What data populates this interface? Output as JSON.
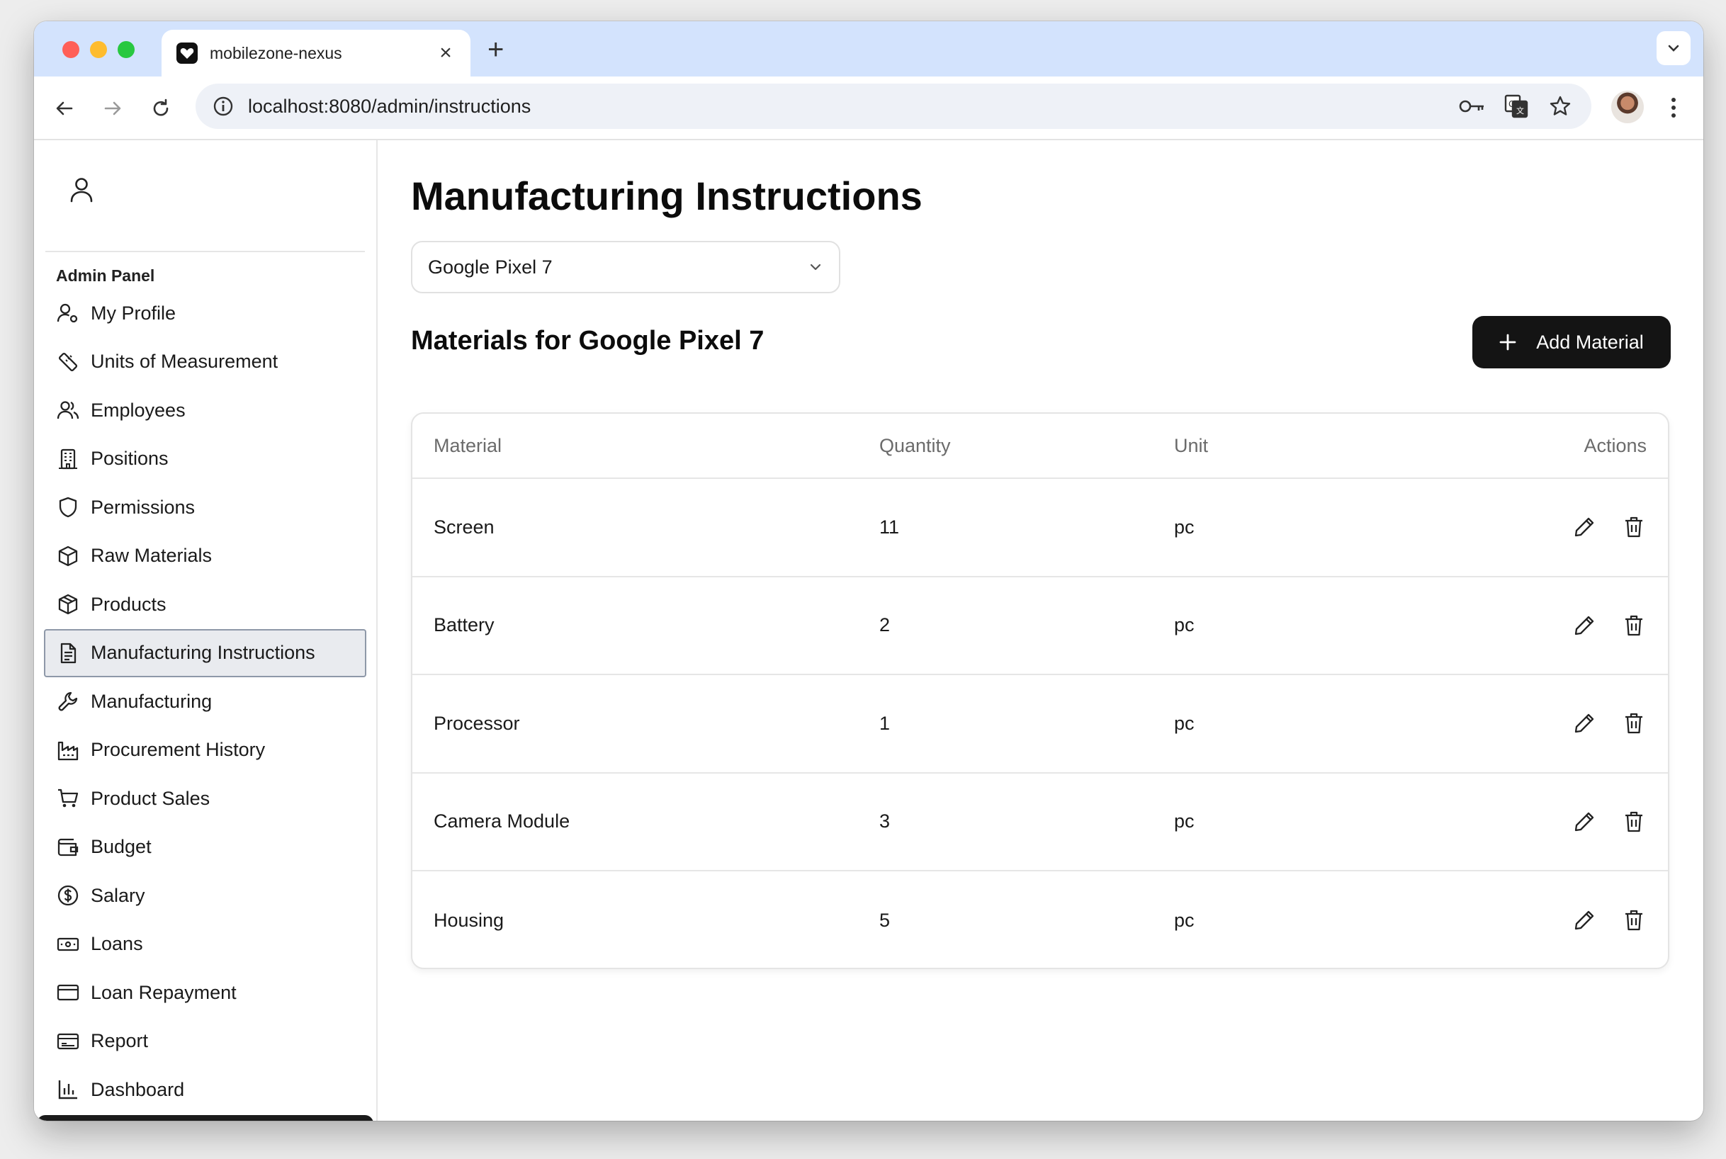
{
  "browser": {
    "tab_title": "mobilezone-nexus",
    "url": "localhost:8080/admin/instructions"
  },
  "sidebar": {
    "panel_label": "Admin Panel",
    "items": [
      {
        "label": "My Profile",
        "icon": "user-settings-icon"
      },
      {
        "label": "Units of Measurement",
        "icon": "ruler-icon"
      },
      {
        "label": "Employees",
        "icon": "users-icon"
      },
      {
        "label": "Positions",
        "icon": "building-icon"
      },
      {
        "label": "Permissions",
        "icon": "shield-icon"
      },
      {
        "label": "Raw Materials",
        "icon": "box-icon"
      },
      {
        "label": "Products",
        "icon": "package-icon"
      },
      {
        "label": "Manufacturing Instructions",
        "icon": "document-icon",
        "active": true
      },
      {
        "label": "Manufacturing",
        "icon": "wrench-icon"
      },
      {
        "label": "Procurement History",
        "icon": "factory-icon"
      },
      {
        "label": "Product Sales",
        "icon": "cart-icon"
      },
      {
        "label": "Budget",
        "icon": "wallet-icon"
      },
      {
        "label": "Salary",
        "icon": "dollar-circle-icon"
      },
      {
        "label": "Loans",
        "icon": "banknote-icon"
      },
      {
        "label": "Loan Repayment",
        "icon": "credit-card-icon"
      },
      {
        "label": "Report",
        "icon": "report-card-icon"
      },
      {
        "label": "Dashboard",
        "icon": "bar-chart-icon"
      }
    ]
  },
  "main": {
    "title": "Manufacturing Instructions",
    "product_select": {
      "value": "Google Pixel 7"
    },
    "section_title": "Materials for Google Pixel 7",
    "add_button_label": "Add Material",
    "table": {
      "headers": {
        "material": "Material",
        "quantity": "Quantity",
        "unit": "Unit",
        "actions": "Actions"
      },
      "rows": [
        {
          "material": "Screen",
          "quantity": "11",
          "unit": "pc"
        },
        {
          "material": "Battery",
          "quantity": "2",
          "unit": "pc"
        },
        {
          "material": "Processor",
          "quantity": "1",
          "unit": "pc"
        },
        {
          "material": "Camera Module",
          "quantity": "3",
          "unit": "pc"
        },
        {
          "material": "Housing",
          "quantity": "5",
          "unit": "pc"
        }
      ]
    }
  }
}
